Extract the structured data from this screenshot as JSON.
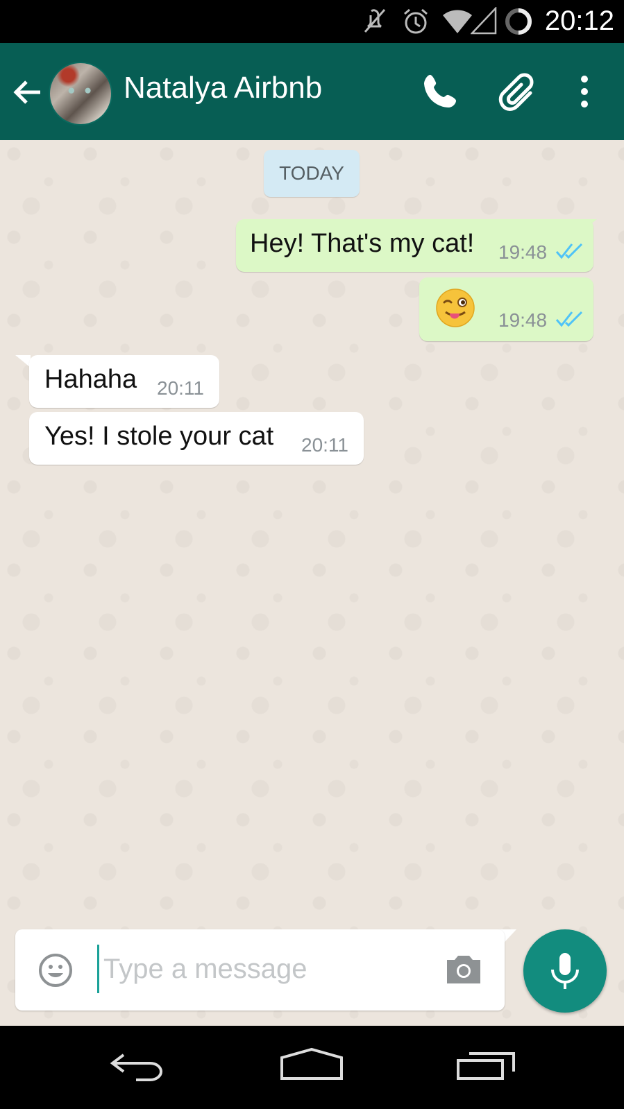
{
  "status_bar": {
    "time": "20:12",
    "icons": [
      "mute-icon",
      "alarm-icon",
      "wifi-icon",
      "signal-icon",
      "loading-icon"
    ]
  },
  "header": {
    "contact_name": "Natalya Airbnb",
    "icons": [
      "back-arrow-icon",
      "avatar",
      "phone-icon",
      "paperclip-icon",
      "more-vert-icon"
    ]
  },
  "chat": {
    "date_label": "TODAY",
    "messages": [
      {
        "direction": "outgoing",
        "text": "Hey! That's my cat!",
        "time": "19:48",
        "status": "read"
      },
      {
        "direction": "outgoing",
        "text": "",
        "emoji": "winking-face-with-tongue",
        "time": "19:48",
        "status": "read"
      },
      {
        "direction": "incoming",
        "text": "Hahaha",
        "time": "20:11"
      },
      {
        "direction": "incoming",
        "text": "Yes! I stole your cat",
        "time": "20:11"
      }
    ]
  },
  "composer": {
    "placeholder": "Type a message",
    "value": "",
    "icons": [
      "emoji-icon",
      "camera-icon",
      "mic-icon"
    ]
  },
  "colors": {
    "header_bg": "#075e54",
    "chat_bg": "#ece5dd",
    "outgoing_bubble": "#dcf8c6",
    "incoming_bubble": "#ffffff",
    "read_ticks": "#4fc3f7",
    "accent": "#128c7e"
  },
  "nav_bar": {
    "icons": [
      "nav-back-icon",
      "nav-home-icon",
      "nav-recents-icon"
    ]
  }
}
